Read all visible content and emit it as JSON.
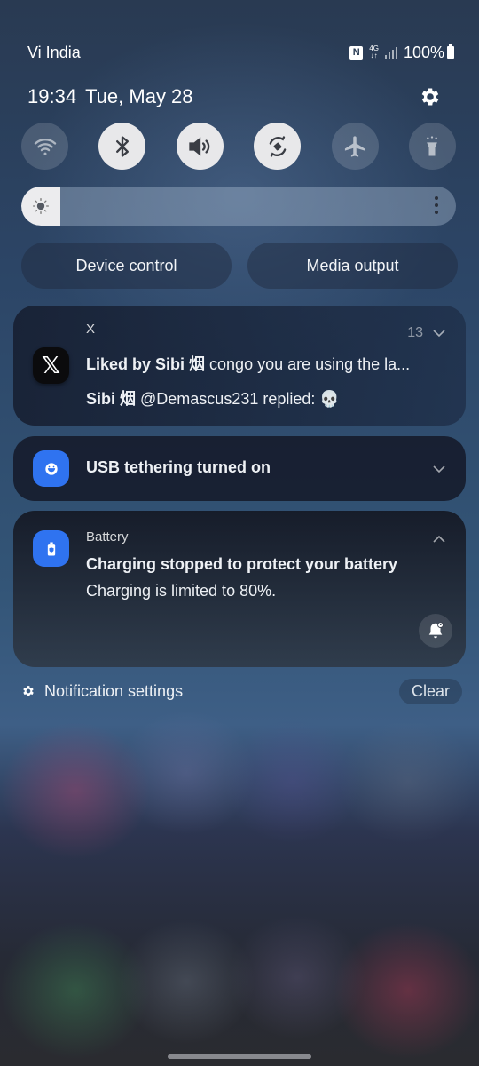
{
  "status_bar": {
    "carrier": "Vi India",
    "nfc_icon": "N",
    "network_type": "4G",
    "battery_percent": "100%"
  },
  "header": {
    "time": "19:34",
    "date": "Tue, May 28"
  },
  "quick_settings": {
    "tiles": [
      {
        "name": "wifi",
        "icon": "wifi-icon",
        "state": "off"
      },
      {
        "name": "bluetooth",
        "icon": "bluetooth-icon",
        "state": "on"
      },
      {
        "name": "sound",
        "icon": "volume-icon",
        "state": "on"
      },
      {
        "name": "auto-rotate",
        "icon": "rotate-icon",
        "state": "on"
      },
      {
        "name": "airplane-mode",
        "icon": "airplane-icon",
        "state": "off"
      },
      {
        "name": "flashlight",
        "icon": "flashlight-icon",
        "state": "off"
      }
    ],
    "brightness_level": 0.04,
    "buttons": {
      "device_control": "Device control",
      "media_output": "Media output"
    }
  },
  "notifications": [
    {
      "app": "X",
      "count": "13",
      "icon_glyph": "𝕏",
      "line1_bold": "Liked by Sibi 烟",
      "line1_text": " congo you are using the la...",
      "line2_bold": "Sibi 烟",
      "line2_text": " @Demascus231 replied: 💀"
    },
    {
      "app": "USB tethering",
      "title": "USB tethering turned on"
    },
    {
      "app": "Battery",
      "title": "Charging stopped to protect your battery",
      "body": "Charging is limited to 80%."
    }
  ],
  "footer": {
    "notification_settings": "Notification settings",
    "clear": "Clear"
  },
  "colors": {
    "accent_blue": "#2f73f0",
    "tile_on": "#e8e8ea"
  }
}
